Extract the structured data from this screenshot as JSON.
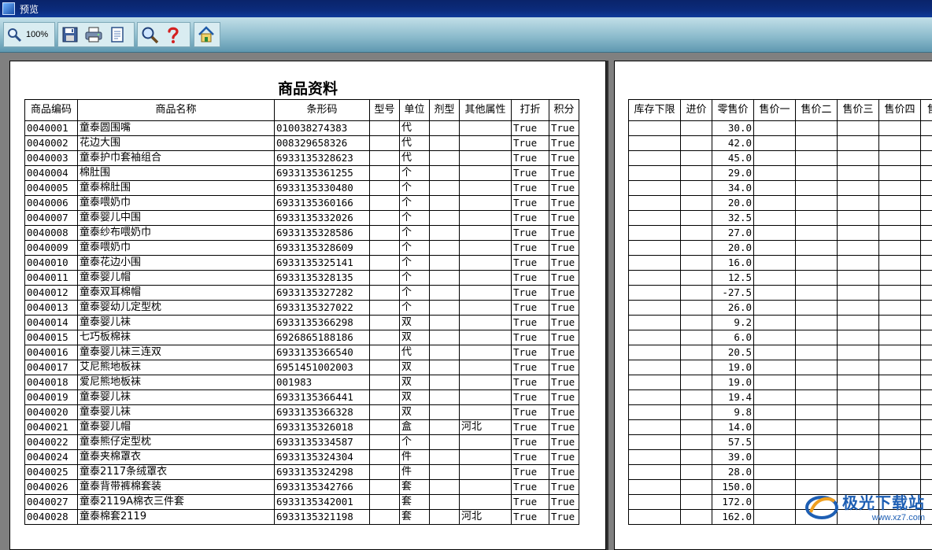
{
  "window": {
    "title": "预览"
  },
  "toolbar": {
    "zoom_label": "100%"
  },
  "document": {
    "title": "商品资料",
    "left_headers": [
      "商品编码",
      "商品名称",
      "条形码",
      "型号",
      "单位",
      "剂型",
      "其他属性",
      "打折",
      "积分"
    ],
    "right_headers": [
      "库存下限",
      "进价",
      "零售价",
      "售价一",
      "售价二",
      "售价三",
      "售价四",
      "售"
    ],
    "rows": [
      [
        "0040001",
        "童泰圆围嘴",
        "010038274383",
        "",
        "代",
        "",
        "",
        "True",
        "True",
        "30.0"
      ],
      [
        "0040002",
        "花边大围",
        "008329658326",
        "",
        "代",
        "",
        "",
        "True",
        "True",
        "42.0"
      ],
      [
        "0040003",
        "童泰护巾套袖组合",
        "6933135328623",
        "",
        "代",
        "",
        "",
        "True",
        "True",
        "45.0"
      ],
      [
        "0040004",
        "棉肚围",
        "6933135361255",
        "",
        "个",
        "",
        "",
        "True",
        "True",
        "29.0"
      ],
      [
        "0040005",
        "童泰棉肚围",
        "6933135330480",
        "",
        "个",
        "",
        "",
        "True",
        "True",
        "34.0"
      ],
      [
        "0040006",
        "童泰喂奶巾",
        "6933135360166",
        "",
        "个",
        "",
        "",
        "True",
        "True",
        "20.0"
      ],
      [
        "0040007",
        "童泰婴儿中围",
        "6933135332026",
        "",
        "个",
        "",
        "",
        "True",
        "True",
        "32.5"
      ],
      [
        "0040008",
        "童泰纱布喂奶巾",
        "6933135328586",
        "",
        "个",
        "",
        "",
        "True",
        "True",
        "27.0"
      ],
      [
        "0040009",
        "童泰喂奶巾",
        "6933135328609",
        "",
        "个",
        "",
        "",
        "True",
        "True",
        "20.0"
      ],
      [
        "0040010",
        "童泰花边小围",
        "6933135325141",
        "",
        "个",
        "",
        "",
        "True",
        "True",
        "16.0"
      ],
      [
        "0040011",
        "童泰婴儿帽",
        "6933135328135",
        "",
        "个",
        "",
        "",
        "True",
        "True",
        "12.5"
      ],
      [
        "0040012",
        "童泰双耳棉帽",
        "6933135327282",
        "",
        "个",
        "",
        "",
        "True",
        "True",
        "-27.5"
      ],
      [
        "0040013",
        "童泰婴幼儿定型枕",
        "6933135327022",
        "",
        "个",
        "",
        "",
        "True",
        "True",
        "26.0"
      ],
      [
        "0040014",
        "童泰婴儿袜",
        "6933135366298",
        "",
        "双",
        "",
        "",
        "True",
        "True",
        "9.2"
      ],
      [
        "0040015",
        "七巧板棉袜",
        "6926865188186",
        "",
        "双",
        "",
        "",
        "True",
        "True",
        "6.0"
      ],
      [
        "0040016",
        "童泰婴儿袜三连双",
        "6933135366540",
        "",
        "代",
        "",
        "",
        "True",
        "True",
        "20.5"
      ],
      [
        "0040017",
        "艾尼熊地板袜",
        "6951451002003",
        "",
        "双",
        "",
        "",
        "True",
        "True",
        "19.0"
      ],
      [
        "0040018",
        "爱尼熊地板袜",
        "001983",
        "",
        "双",
        "",
        "",
        "True",
        "True",
        "19.0"
      ],
      [
        "0040019",
        "童泰婴儿袜",
        "6933135366441",
        "",
        "双",
        "",
        "",
        "True",
        "True",
        "19.4"
      ],
      [
        "0040020",
        "童泰婴儿袜",
        "6933135366328",
        "",
        "双",
        "",
        "",
        "True",
        "True",
        "9.8"
      ],
      [
        "0040021",
        "童泰婴儿帽",
        "6933135326018",
        "",
        "盒",
        "",
        "河北",
        "True",
        "True",
        "14.0"
      ],
      [
        "0040022",
        "童泰熊仔定型枕",
        "6933135334587",
        "",
        "个",
        "",
        "",
        "True",
        "True",
        "57.5"
      ],
      [
        "0040024",
        "童泰夹棉罩衣",
        "6933135324304",
        "",
        "件",
        "",
        "",
        "True",
        "True",
        "39.0"
      ],
      [
        "0040025",
        "童泰2117条绒罩衣",
        "6933135324298",
        "",
        "件",
        "",
        "",
        "True",
        "True",
        "28.0"
      ],
      [
        "0040026",
        "童泰背带裤棉套装",
        "6933135342766",
        "",
        "套",
        "",
        "",
        "True",
        "True",
        "150.0"
      ],
      [
        "0040027",
        "童泰2119A棉衣三件套",
        "6933135342001",
        "",
        "套",
        "",
        "",
        "True",
        "True",
        "172.0"
      ],
      [
        "0040028",
        "童泰棉套2119",
        "6933135321198",
        "",
        "套",
        "",
        "河北",
        "True",
        "True",
        "162.0"
      ]
    ]
  },
  "watermark": {
    "name": "极光下载站",
    "url": "www.xz7.com"
  },
  "colors": {
    "titlebar": "#0a246a",
    "toolbar": "#8dbccd",
    "workspace": "#808080"
  }
}
